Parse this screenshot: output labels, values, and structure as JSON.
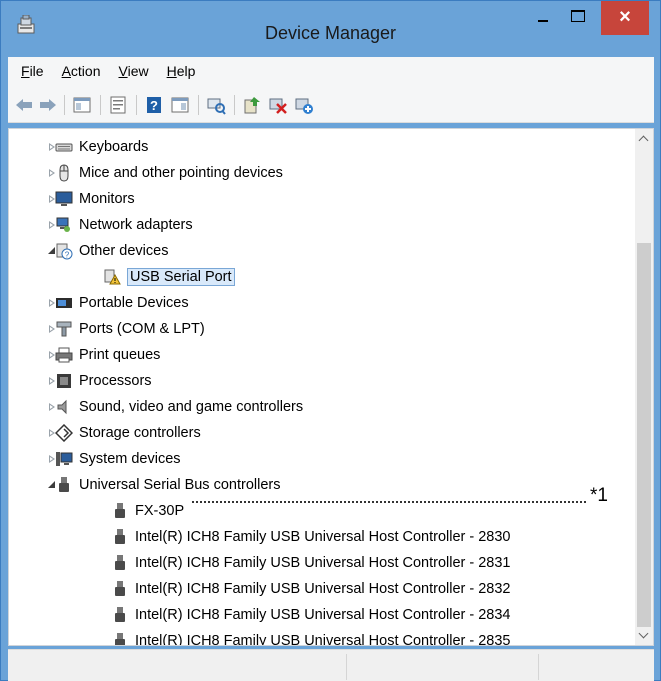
{
  "window": {
    "title": "Device Manager",
    "close_glyph": "×"
  },
  "menu": [
    {
      "pre": "",
      "key": "F",
      "post": "ile"
    },
    {
      "pre": "",
      "key": "A",
      "post": "ction"
    },
    {
      "pre": "",
      "key": "V",
      "post": "iew"
    },
    {
      "pre": "",
      "key": "H",
      "post": "elp"
    }
  ],
  "toolbar": {
    "icons": [
      "back-arrow-icon",
      "forward-arrow-icon",
      "show-hide-console-tree-icon",
      "properties-icon",
      "help-icon",
      "action-pane-icon",
      "scan-hardware-changes-icon",
      "update-driver-icon",
      "uninstall-device-icon",
      "add-legacy-hardware-icon"
    ]
  },
  "tree": {
    "items": [
      {
        "label": "Keyboards",
        "state": "collapsed",
        "icon": "keyboard-icon",
        "level": 1
      },
      {
        "label": "Mice and other pointing devices",
        "state": "collapsed",
        "icon": "mouse-icon",
        "level": 1
      },
      {
        "label": "Monitors",
        "state": "collapsed",
        "icon": "monitor-icon",
        "level": 1
      },
      {
        "label": "Network adapters",
        "state": "collapsed",
        "icon": "network-adapter-icon",
        "level": 1
      },
      {
        "label": "Other devices",
        "state": "expanded",
        "icon": "other-devices-icon",
        "level": 1
      },
      {
        "label": "USB Serial Port",
        "state": "none",
        "icon": "warning-device-icon",
        "level": 2,
        "selected": true
      },
      {
        "label": "Portable Devices",
        "state": "collapsed",
        "icon": "portable-device-icon",
        "level": 1
      },
      {
        "label": "Ports (COM & LPT)",
        "state": "collapsed",
        "icon": "port-icon",
        "level": 1
      },
      {
        "label": "Print queues",
        "state": "collapsed",
        "icon": "printer-icon",
        "level": 1
      },
      {
        "label": "Processors",
        "state": "collapsed",
        "icon": "processor-icon",
        "level": 1
      },
      {
        "label": "Sound, video and game controllers",
        "state": "collapsed",
        "icon": "speaker-icon",
        "level": 1
      },
      {
        "label": "Storage controllers",
        "state": "collapsed",
        "icon": "storage-controller-icon",
        "level": 1
      },
      {
        "label": "System devices",
        "state": "collapsed",
        "icon": "system-device-icon",
        "level": 1
      },
      {
        "label": "Universal Serial Bus controllers",
        "state": "expanded",
        "icon": "usb-icon",
        "level": 1
      },
      {
        "label": "FX-30P",
        "state": "none",
        "icon": "usb-icon",
        "level": 2
      },
      {
        "label": "Intel(R) ICH8 Family USB Universal Host Controller - 2830",
        "state": "none",
        "icon": "usb-icon",
        "level": 2
      },
      {
        "label": "Intel(R) ICH8 Family USB Universal Host Controller - 2831",
        "state": "none",
        "icon": "usb-icon",
        "level": 2
      },
      {
        "label": "Intel(R) ICH8 Family USB Universal Host Controller - 2832",
        "state": "none",
        "icon": "usb-icon",
        "level": 2
      },
      {
        "label": "Intel(R) ICH8 Family USB Universal Host Controller - 2834",
        "state": "none",
        "icon": "usb-icon",
        "level": 2
      },
      {
        "label": "Intel(R) ICH8 Family USB Universal Host Controller - 2835",
        "state": "none",
        "icon": "usb-icon",
        "level": 2
      }
    ]
  },
  "annotation": {
    "mark": "*1"
  },
  "colors": {
    "titlebar": "#6aa3d8",
    "close": "#c7453b",
    "selection": "#d9e9fa"
  }
}
